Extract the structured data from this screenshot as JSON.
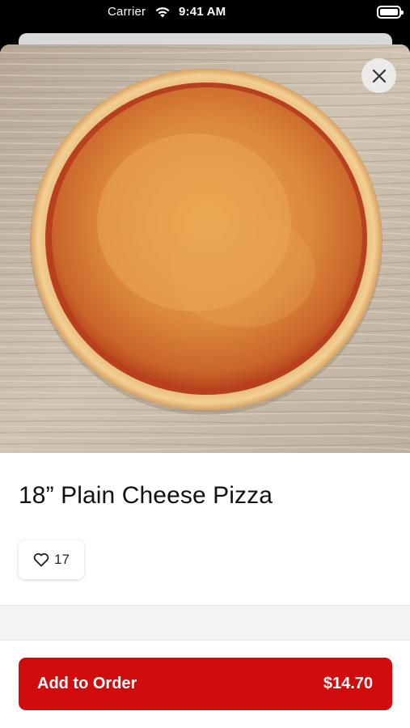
{
  "status_bar": {
    "carrier": "Carrier",
    "time": "9:41 AM",
    "wifi_icon": "wifi-icon",
    "battery_icon": "battery-icon"
  },
  "product": {
    "image_icon": "pizza-photo",
    "title": "18” Plain Cheese Pizza",
    "likes": "17",
    "like_icon": "heart-outline-icon"
  },
  "actions": {
    "close_icon": "close-icon",
    "add_label": "Add to Order",
    "price": "$14.70"
  },
  "colors": {
    "accent": "#d00c0c",
    "background": "#ffffff",
    "divider": "#f4f4f4"
  }
}
